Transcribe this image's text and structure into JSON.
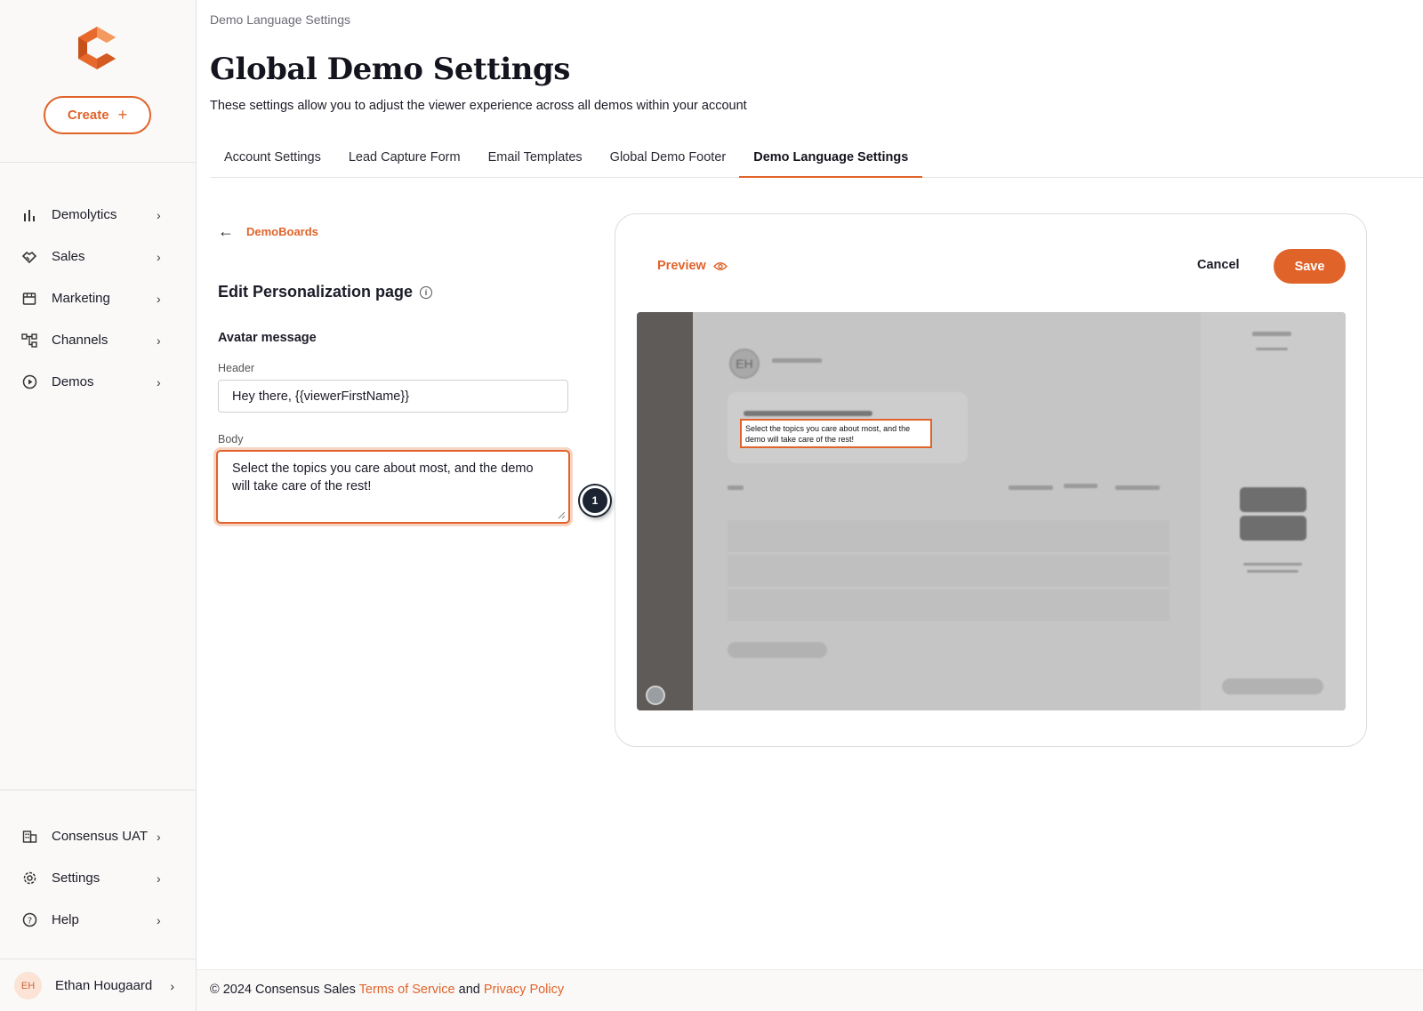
{
  "sidebar": {
    "create_label": "Create",
    "nav": [
      {
        "label": "Demolytics",
        "icon": "bar-chart-icon"
      },
      {
        "label": "Sales",
        "icon": "handshake-icon"
      },
      {
        "label": "Marketing",
        "icon": "storefront-icon"
      },
      {
        "label": "Channels",
        "icon": "network-icon"
      },
      {
        "label": "Demos",
        "icon": "play-circle-icon"
      }
    ],
    "bottom_nav": [
      {
        "label": "Consensus UAT",
        "icon": "building-icon"
      },
      {
        "label": "Settings",
        "icon": "gear-icon"
      },
      {
        "label": "Help",
        "icon": "help-circle-icon"
      }
    ],
    "user": {
      "initials": "EH",
      "name": "Ethan Hougaard"
    }
  },
  "header": {
    "breadcrumb": "Demo Language Settings",
    "title": "Global Demo Settings",
    "subtitle": "These settings allow you to adjust the viewer experience across all demos within your account"
  },
  "tabs": [
    {
      "label": "Account Settings",
      "active": false
    },
    {
      "label": "Lead Capture Form",
      "active": false
    },
    {
      "label": "Email Templates",
      "active": false
    },
    {
      "label": "Global Demo Footer",
      "active": false
    },
    {
      "label": "Demo Language Settings",
      "active": true
    }
  ],
  "editor": {
    "back_label": "DemoBoards",
    "section_title": "Edit Personalization page",
    "sub_title": "Avatar message",
    "header_label": "Header",
    "header_value": "Hey there, {{viewerFirstName}}",
    "body_label": "Body",
    "body_value": "Select the topics you care about most, and the demo will take care of the rest!",
    "step_number": "1"
  },
  "preview": {
    "label": "Preview",
    "cancel_label": "Cancel",
    "save_label": "Save",
    "avatar_initials": "EH",
    "callout_text": "Select the topics you care about most, and the demo will take care of the rest!"
  },
  "footer": {
    "copyright": "© 2024 Consensus Sales",
    "terms": "Terms of Service",
    "and": "and",
    "privacy": "Privacy Policy"
  },
  "colors": {
    "accent": "#e0642a",
    "dark": "#1b2430"
  }
}
